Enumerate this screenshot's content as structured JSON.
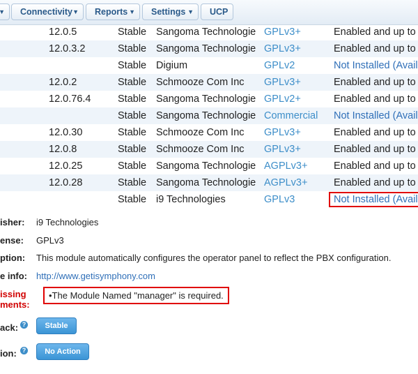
{
  "nav": [
    {
      "label": "Connectivity"
    },
    {
      "label": "Reports"
    },
    {
      "label": "Settings"
    },
    {
      "label": "UCP"
    }
  ],
  "modules": [
    {
      "version": "12.0.5",
      "track": "Stable",
      "publisher": "Sangoma Technologie",
      "license": "GPLv3+",
      "status": "Enabled and up to",
      "status_is_link": false
    },
    {
      "version": "12.0.3.2",
      "track": "Stable",
      "publisher": "Sangoma Technologie",
      "license": "GPLv3+",
      "status": "Enabled and up to",
      "status_is_link": false
    },
    {
      "version": "",
      "track": "Stable",
      "publisher": "Digium",
      "license": "GPLv2",
      "status": "Not Installed (Availa",
      "status_is_link": true
    },
    {
      "version": "12.0.2",
      "track": "Stable",
      "publisher": "Schmooze Com Inc",
      "license": "GPLv3+",
      "status": "Enabled and up to",
      "status_is_link": false
    },
    {
      "version": "12.0.76.4",
      "track": "Stable",
      "publisher": "Sangoma Technologie",
      "license": "GPLv2+",
      "status": "Enabled and up to",
      "status_is_link": false
    },
    {
      "version": "",
      "track": "Stable",
      "publisher": "Sangoma Technologie",
      "license": "Commercial",
      "status": "Not Installed (Availa",
      "status_is_link": true
    },
    {
      "version": "12.0.30",
      "track": "Stable",
      "publisher": "Schmooze Com Inc",
      "license": "GPLv3+",
      "status": "Enabled and up to",
      "status_is_link": false
    },
    {
      "version": "12.0.8",
      "track": "Stable",
      "publisher": "Schmooze Com Inc",
      "license": "GPLv3+",
      "status": "Enabled and up to",
      "status_is_link": false
    },
    {
      "version": "12.0.25",
      "track": "Stable",
      "publisher": "Sangoma Technologie",
      "license": "AGPLv3+",
      "status": "Enabled and up to",
      "status_is_link": false
    },
    {
      "version": "12.0.28",
      "track": "Stable",
      "publisher": "Sangoma Technologie",
      "license": "AGPLv3+",
      "status": "Enabled and up to",
      "status_is_link": false
    },
    {
      "version": "",
      "track": "Stable",
      "publisher": "i9 Technologies",
      "license": "GPLv3",
      "status": "Not Installed (Availa",
      "status_is_link": true
    }
  ],
  "details": {
    "publisher_label": "isher:",
    "publisher_value": "i9 Technologies",
    "license_label": "ense:",
    "license_value": "GPLv3",
    "description_label": "ption:",
    "description_value": "This module automatically configures the operator panel to reflect the PBX configuration.",
    "moreinfo_label": "e info:",
    "moreinfo_value": "http://www.getisymphony.com",
    "missing_label_1": "issing",
    "missing_label_2": "ments:",
    "requirement_text": "•The Module Named \"manager\" is required.",
    "track_label": "ack:",
    "track_button": "Stable",
    "action_label": "ion:",
    "action_button": "No Action",
    "help_glyph": "?"
  }
}
